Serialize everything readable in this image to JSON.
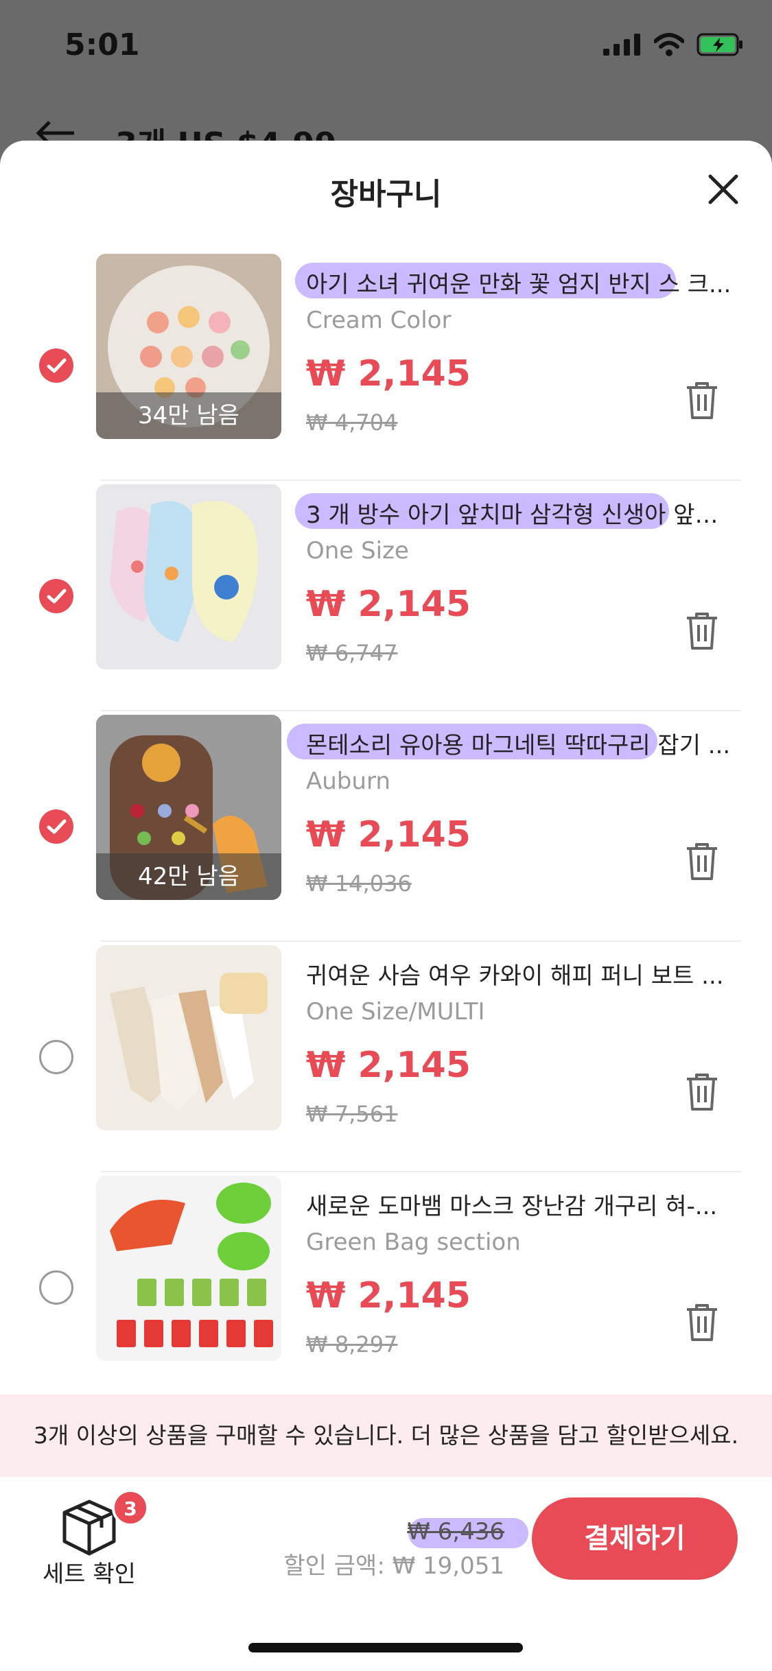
{
  "status": {
    "time": "5:01"
  },
  "behind_header": {
    "title": "3개 US $4.99"
  },
  "sheet": {
    "title": "장바구니"
  },
  "items": [
    {
      "name": "아기 소녀 귀여운 만화 꽃 엄지 반지 스 크...",
      "variant": "Cream Color",
      "price": "₩ 2,145",
      "original": "₩ 4,704",
      "stock": "34만 남음",
      "selected": true
    },
    {
      "name": "3 개 방수 아기 앞치마 삼각형 신생아 앞치...",
      "variant": "One Size",
      "price": "₩ 2,145",
      "original": "₩ 6,747",
      "stock": "",
      "selected": true
    },
    {
      "name": "몬테소리 유아용 마그네틱 딱따구리 잡기 ...",
      "variant": "Auburn",
      "price": "₩ 2,145",
      "original": "₩ 14,036",
      "stock": "42만 남음",
      "selected": true
    },
    {
      "name": "귀여운 사슴 여우 카와이 해피 퍼니 보트 ...",
      "variant": "One Size/MULTI",
      "price": "₩ 2,145",
      "original": "₩ 7,561",
      "stock": "",
      "selected": false
    },
    {
      "name": "새로운 도마뱀 마스크 장난감 개구리 혀-...",
      "variant": "Green Bag section",
      "price": "₩ 2,145",
      "original": "₩ 8,297",
      "stock": "",
      "selected": false
    }
  ],
  "notice": "3개 이상의 상품을 구매할 수 있습니다. 더 많은 상품을 담고 할인받으세요.",
  "footer": {
    "set_label": "세트 확인",
    "set_count": "3",
    "total": "₩ 6,436",
    "discount": "할인 금액: ₩ 19,051",
    "pay_label": "결제하기"
  },
  "colors": {
    "accent": "#e84b55",
    "highlight": "#a082ff"
  }
}
